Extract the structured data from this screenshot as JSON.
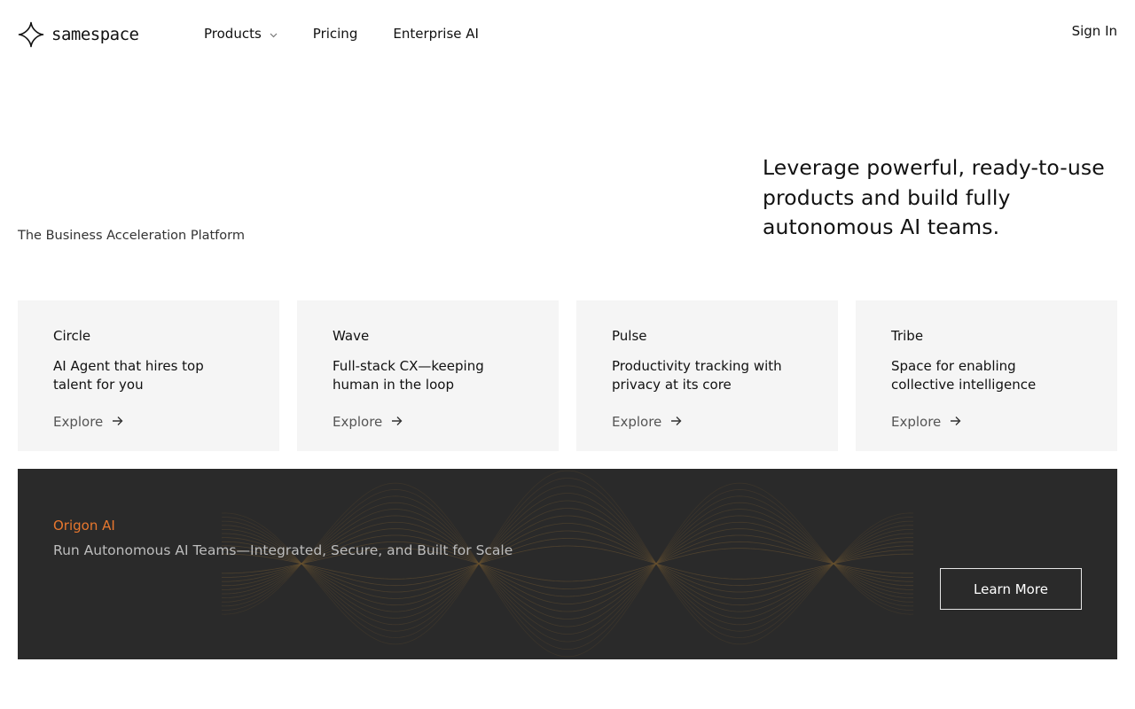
{
  "header": {
    "logo_text": "samespace",
    "logo_icon": "four-point-star-icon",
    "nav": [
      {
        "label": "Products",
        "has_dropdown": true
      },
      {
        "label": "Pricing",
        "has_dropdown": false
      },
      {
        "label": "Enterprise AI",
        "has_dropdown": false
      }
    ],
    "sign_in": "Sign In"
  },
  "hero": {
    "tagline": "The Business Acceleration Platform",
    "headline": "Leverage powerful, ready-to-use products and build fully autonomous AI teams."
  },
  "cards": [
    {
      "title": "Circle",
      "description": "AI Agent that hires top talent for you",
      "cta": "Explore"
    },
    {
      "title": "Wave",
      "description": "Full-stack CX—keeping human in the loop",
      "cta": "Explore"
    },
    {
      "title": "Pulse",
      "description": "Productivity tracking with privacy at its core",
      "cta": "Explore"
    },
    {
      "title": "Tribe",
      "description": "Space for enabling collective intelligence",
      "cta": "Explore"
    }
  ],
  "banner": {
    "eyebrow": "Origon AI",
    "subtitle": "Run Autonomous AI Teams—Integrated, Secure, and Built for Scale",
    "button": "Learn More"
  },
  "colors": {
    "accent_orange": "#e8772e",
    "banner_bg": "#2a2a2a",
    "card_bg": "#f5f5f5"
  }
}
